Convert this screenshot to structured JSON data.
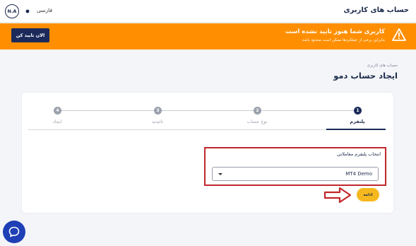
{
  "header": {
    "title": "حساب های کاربری",
    "avatar_initials": "N.A",
    "language": "فارسی",
    "theme_icon": "sun-icon"
  },
  "banner": {
    "title": "کاربری شما هنوز تایید نشده است",
    "subtitle": "بنابراین برخی از عملکردها ممکن است محدود باشد",
    "button_label": "الان تایید کن",
    "icon": "warning-icon",
    "color": "#ff8f00"
  },
  "page": {
    "breadcrumb": "حساب های کاربری",
    "title": "ایجاد حساب دمو"
  },
  "stepper": {
    "steps": [
      {
        "number": "1",
        "label": "پلتفرم",
        "active": true
      },
      {
        "number": "2",
        "label": "نوع حساب",
        "active": false
      },
      {
        "number": "3",
        "label": "تائیدیه",
        "active": false
      },
      {
        "number": "4",
        "label": "ایجاد",
        "active": false
      }
    ]
  },
  "form": {
    "platform_label": "انتخاب پلتفرم معاملاتی",
    "platform_value": "MT4 Demo",
    "continue_label": "ادامه"
  },
  "colors": {
    "primary": "#1b2a5a",
    "accent": "#f5b81e",
    "annotation": "#c0282d",
    "chat": "#1e3fb5"
  }
}
